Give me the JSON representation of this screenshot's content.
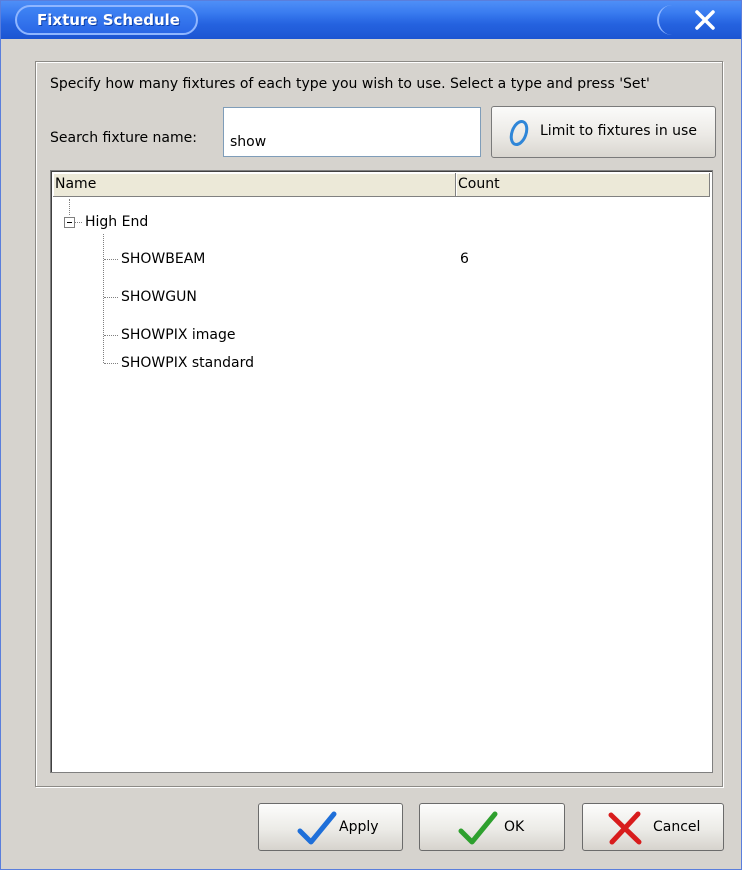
{
  "window": {
    "title": "Fixture Schedule"
  },
  "panel": {
    "instructions": "Specify how many fixtures of each type you wish to use.  Select a type and press 'Set'",
    "search": {
      "label": "Search fixture name:",
      "value": "show"
    },
    "limit_button": {
      "label": "Limit to fixtures in use"
    }
  },
  "tree": {
    "columns": [
      "Name",
      "Count"
    ],
    "group": {
      "label": "High End",
      "expanded": true
    },
    "items": [
      {
        "name": "SHOWBEAM",
        "count": "6"
      },
      {
        "name": "SHOWGUN",
        "count": ""
      },
      {
        "name": "SHOWPIX image",
        "count": ""
      },
      {
        "name": "SHOWPIX standard",
        "count": ""
      }
    ]
  },
  "footer": {
    "apply": "Apply",
    "ok": "OK",
    "cancel": "Cancel"
  },
  "icons": {
    "close": "close-icon",
    "limit": "oval-icon",
    "apply": "checkmark-icon",
    "ok": "checkmark-icon",
    "cancel": "cross-icon"
  },
  "colors": {
    "titlebar": "#2563e0",
    "apply_check": "#1e6fd9",
    "ok_check": "#2ea02e",
    "cancel_cross": "#d81c1c"
  }
}
